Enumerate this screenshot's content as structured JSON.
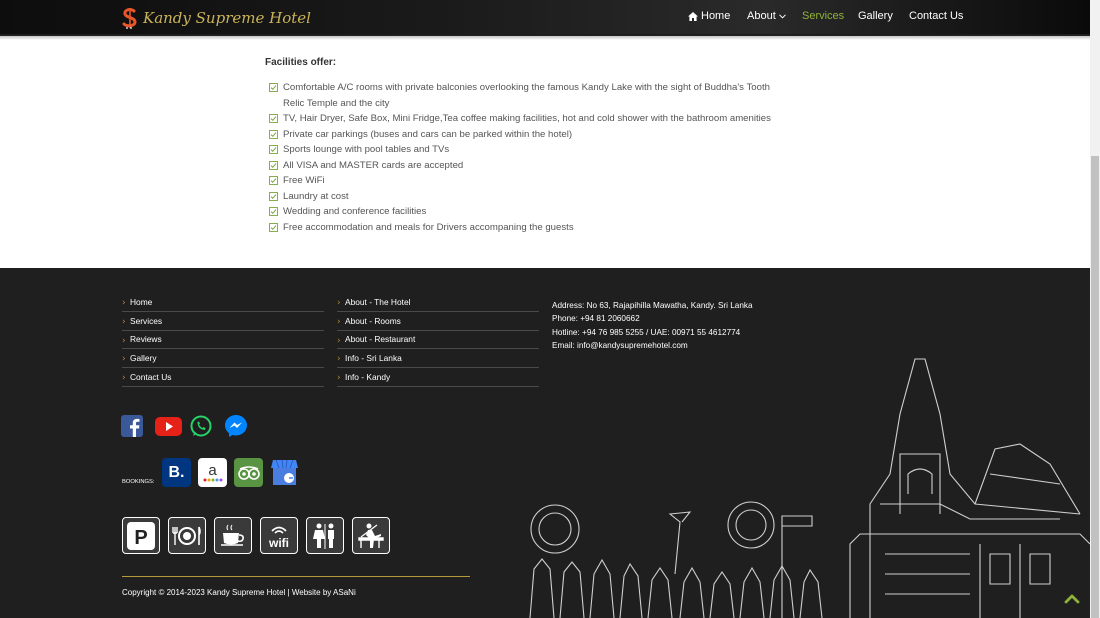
{
  "header": {
    "brand": "Kandy Supreme Hotel",
    "nav": [
      {
        "label": "Home",
        "icon": "home-icon",
        "active": false
      },
      {
        "label": "About",
        "dropdown": true,
        "active": false
      },
      {
        "label": "Services",
        "active": true
      },
      {
        "label": "Gallery",
        "active": false
      },
      {
        "label": "Contact Us",
        "active": false
      }
    ]
  },
  "main": {
    "title": "Facilities offer:",
    "items": [
      "Comfortable A/C rooms with private balconies overlooking the famous Kandy Lake with the sight of Buddha's Tooth",
      "Relic Temple and the city",
      "TV, Hair Dryer, Safe Box, Mini Fridge,Tea coffee making facilities, hot and cold shower with the bathroom amenities",
      "Private car parkings (buses and cars can be parked within the hotel)",
      "Sports lounge with pool tables and TVs",
      "All VISA and MASTER cards are accepted",
      "Free WiFi",
      "Laundry at cost",
      "Wedding and conference facilities",
      "Free accommodation and meals for Drivers accompaning the guests"
    ]
  },
  "footer": {
    "links_left": [
      "Home",
      "Services",
      "Reviews",
      "Gallery",
      "Contact Us"
    ],
    "links_right": [
      "About - The Hotel",
      "About - Rooms",
      "About - Restaurant",
      "Info - Sri Lanka",
      "Info - Kandy"
    ],
    "contact": {
      "address": "Address: No 63, Rajapihilla Mawatha, Kandy. Sri Lanka",
      "phone": "Phone: +94 81 2060662",
      "hotline": "Hotline: +94 76 985 5255 / UAE: 00971 55 4612774",
      "email": "Email: info@kandysupremehotel.com"
    },
    "social": [
      "facebook-icon",
      "youtube-icon",
      "whatsapp-icon",
      "messenger-icon"
    ],
    "bookings_label": "BOOKINGS:",
    "bookings": [
      "booking-com-icon",
      "agoda-icon",
      "tripadvisor-icon",
      "google-business-icon"
    ],
    "booking_letters": {
      "booking": "B.",
      "agoda": "a"
    },
    "amenities": [
      "parking-icon",
      "restaurant-icon",
      "coffee-icon",
      "wifi-icon",
      "restroom-icon",
      "lounge-icon"
    ],
    "amenity_labels": {
      "parking": "P",
      "wifi": "wifi"
    },
    "copyright": "Copyright © 2014-2023 Kandy Supreme Hotel  |  Website by ASaNi"
  },
  "colors": {
    "accent_green": "#8fb339",
    "gold": "#b59a3c",
    "footer_bg": "#1f1f1f",
    "check_green": "#7aa53a"
  }
}
